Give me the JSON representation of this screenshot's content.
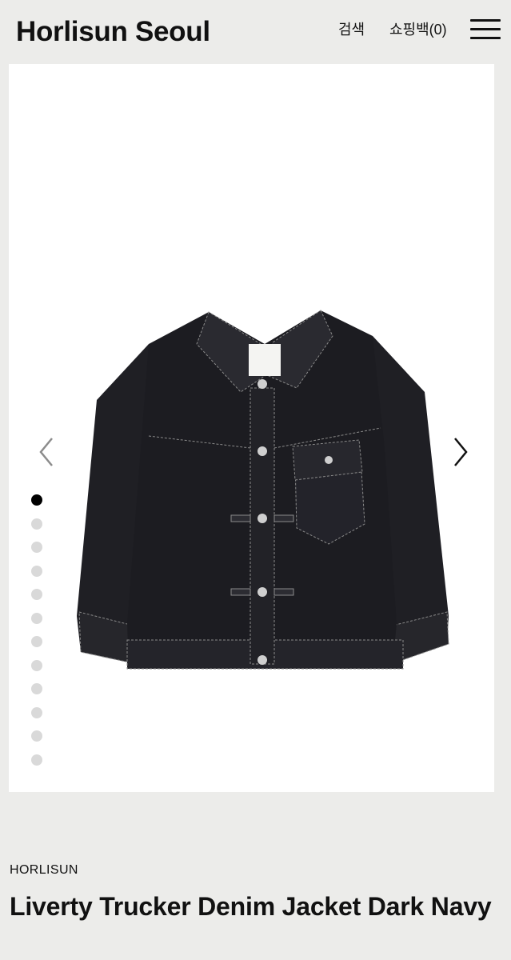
{
  "header": {
    "brand": "Horlisun Seoul",
    "search_label": "검색",
    "cart_label": "쇼핑백(0)",
    "menu_icon": "hamburger-menu-icon"
  },
  "gallery": {
    "image_alt": "Dark navy denim trucker jacket",
    "prev_icon": "chevron-left-icon",
    "next_icon": "chevron-right-icon",
    "slide_count": 12,
    "active_slide": 1
  },
  "product": {
    "brand": "HORLISUN",
    "name": "Liverty Trucker Denim Jacket Dark Navy"
  },
  "colors": {
    "background": "#ececea",
    "image_background": "#ffffff",
    "denim": "#1e1e22",
    "active_dot": "#000000",
    "inactive_dot": "#d9d9d9"
  }
}
